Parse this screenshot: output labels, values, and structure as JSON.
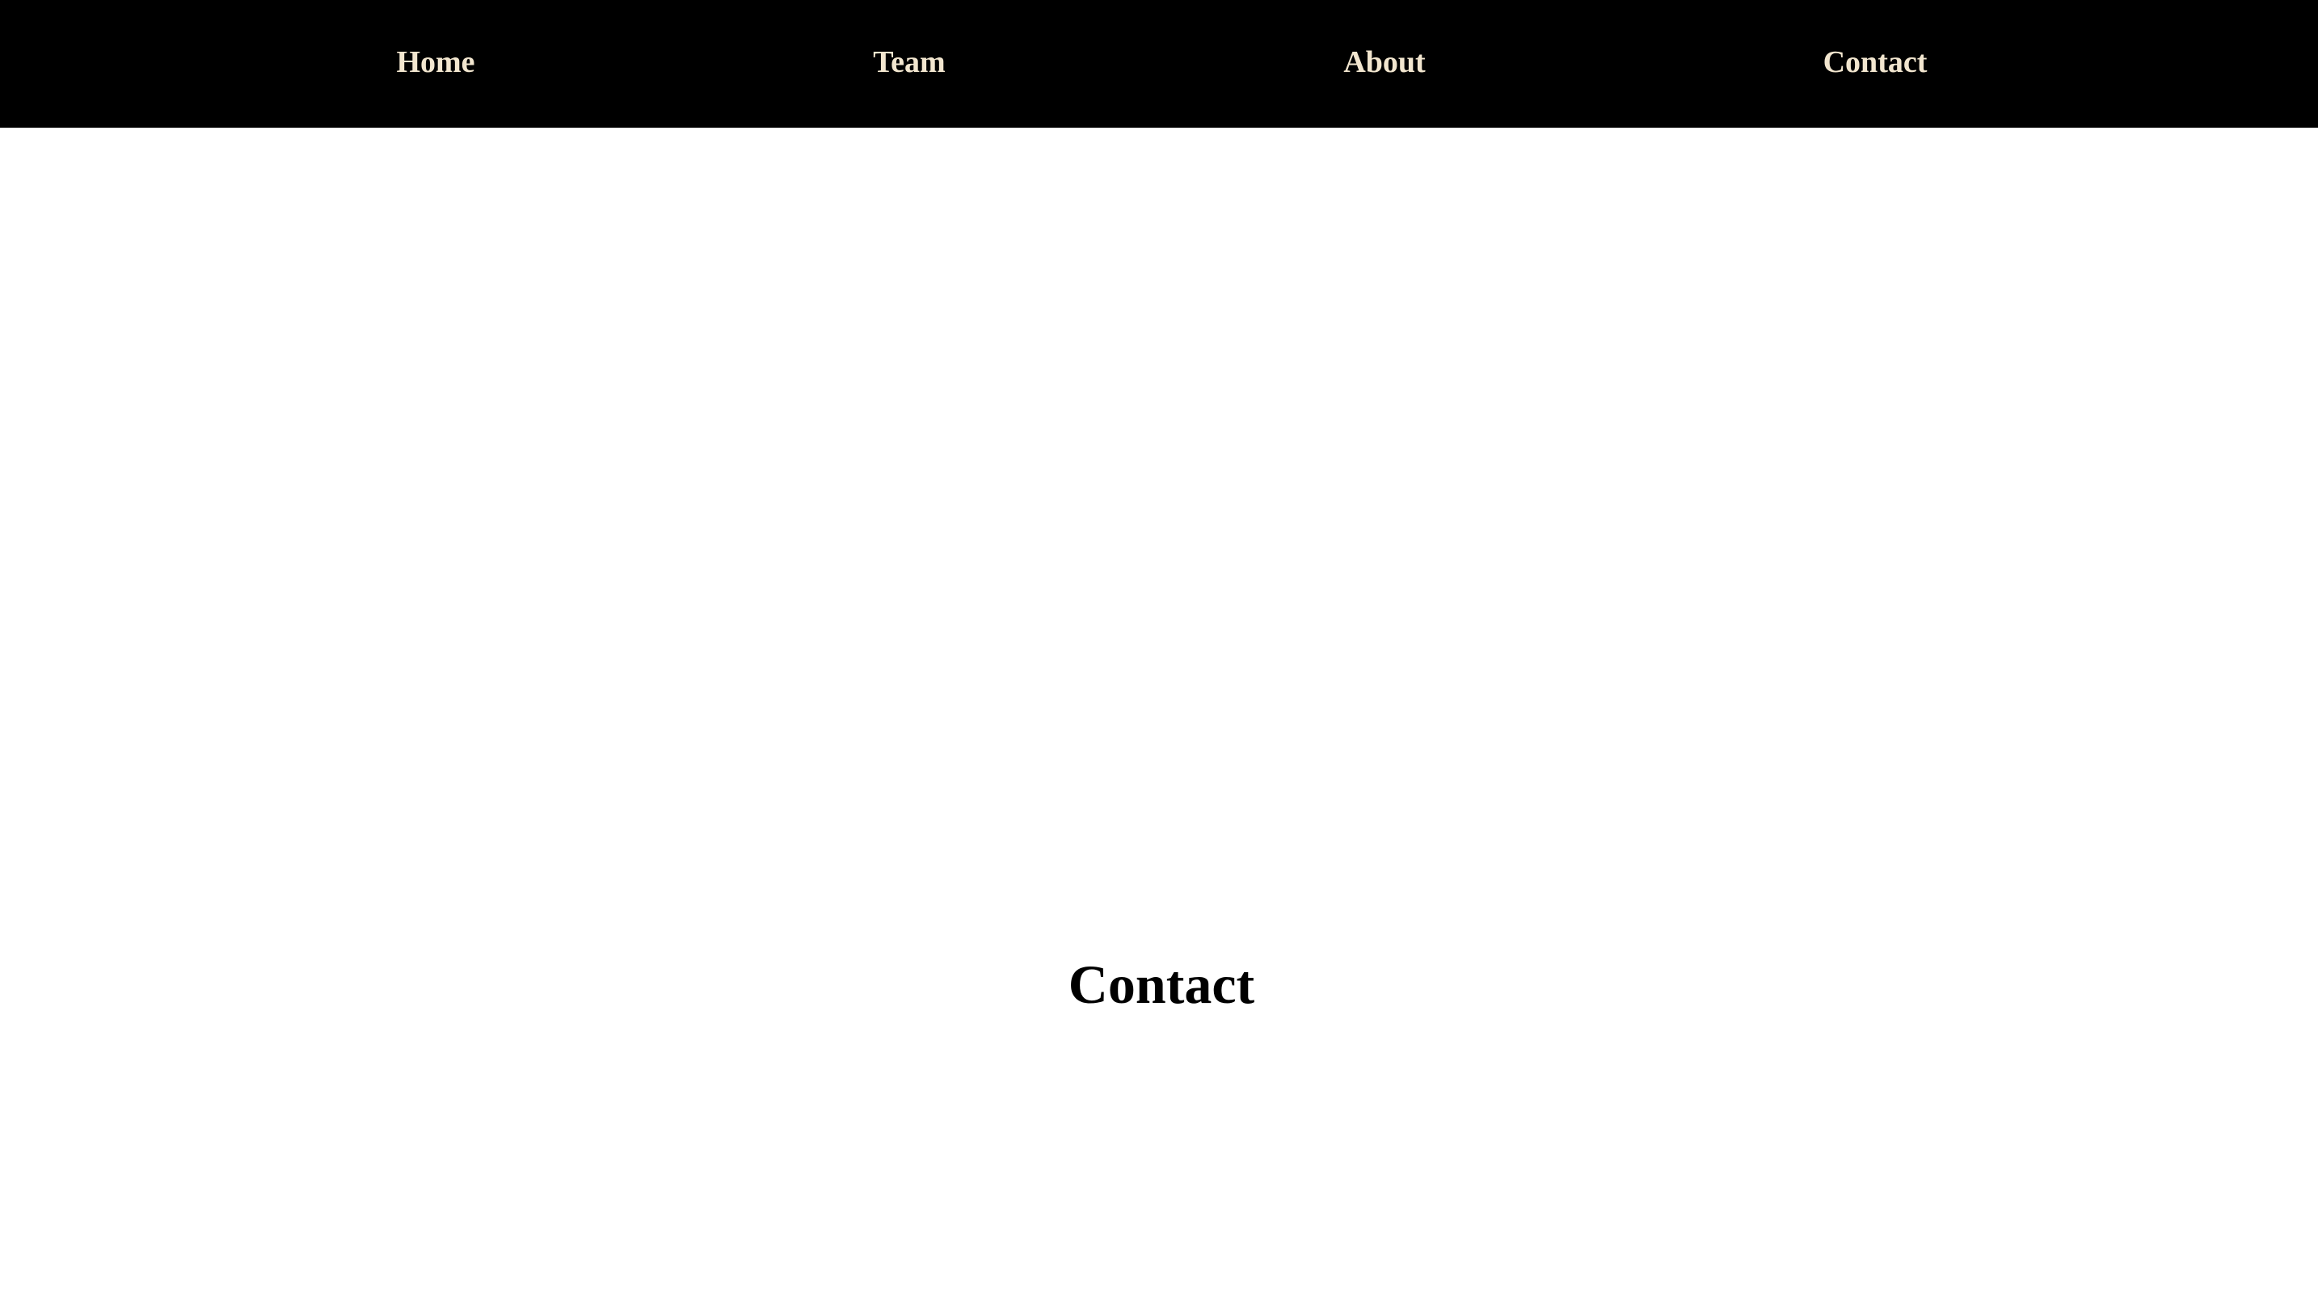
{
  "nav": {
    "items": [
      {
        "label": "Home"
      },
      {
        "label": "Team"
      },
      {
        "label": "About"
      },
      {
        "label": "Contact"
      }
    ]
  },
  "main": {
    "heading": "Contact"
  },
  "colors": {
    "nav_background": "#000000",
    "nav_text": "#f2e6cf",
    "page_background": "#ffffff",
    "heading_text": "#000000"
  }
}
